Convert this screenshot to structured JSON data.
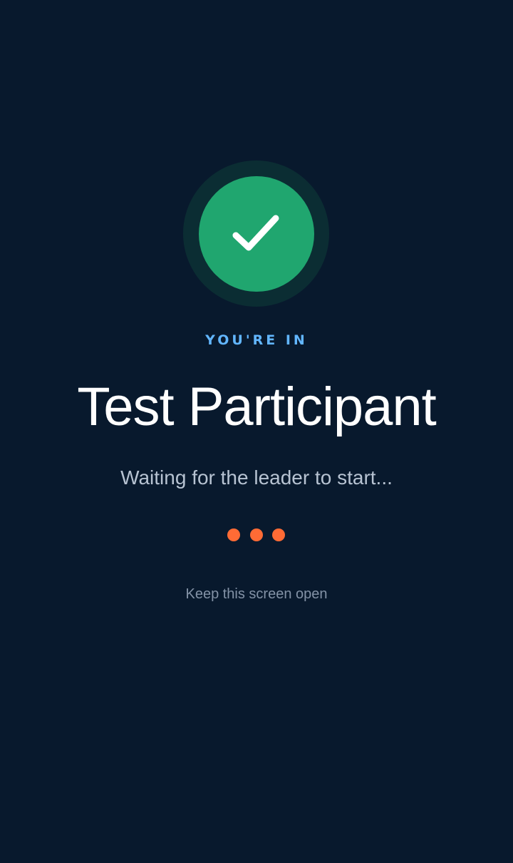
{
  "status": {
    "icon": "checkmark-icon",
    "eyebrow": "YOU'RE IN"
  },
  "participant": {
    "name": "Test Participant"
  },
  "messages": {
    "waiting": "Waiting for the leader to start...",
    "keep_open": "Keep this screen open"
  },
  "colors": {
    "background": "#08192d",
    "success": "#20a66f",
    "accent": "#62b6ff",
    "loading_dots": "#ff6b35"
  }
}
